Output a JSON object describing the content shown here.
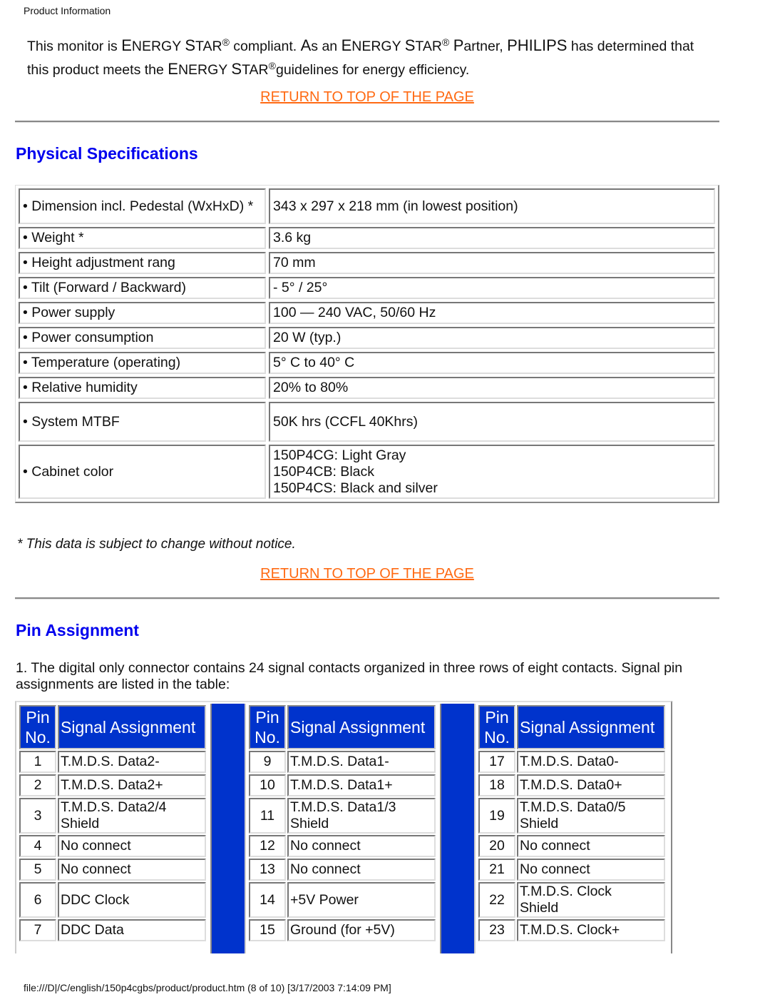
{
  "header": {
    "title": "Product Information"
  },
  "energy_star": {
    "p1": "This monitor is ",
    "es_E": "E",
    "es_NERGY": "NERGY ",
    "es_S": "S",
    "es_TAR": "TAR",
    "reg": "®",
    "p2": " compliant. ",
    "as_A": "A",
    "p3": "s an ",
    "p4": " ",
    "partner_P": "P",
    "p5": "artner, ",
    "philips": "PHILIPS",
    "p6": " has determined that this product meets the ",
    "p7": "guidelines for energy efficiency."
  },
  "links": {
    "return_top": "RETURN TO TOP OF THE PAGE"
  },
  "physical": {
    "title": "Physical Specifications",
    "rows": [
      {
        "label": "• Dimension incl. Pedestal (WxHxD) *",
        "value": "343 x 297 x 218 mm (in lowest position)"
      },
      {
        "label": "• Weight *",
        "value": "3.6 kg"
      },
      {
        "label": "• Height adjustment rang",
        "value": "70 mm"
      },
      {
        "label": "• Tilt (Forward / Backward)",
        "value": "- 5° / 25°"
      },
      {
        "label": "• Power supply",
        "value": "100 — 240 VAC, 50/60 Hz"
      },
      {
        "label": "• Power consumption",
        "value": "20 W (typ.)"
      },
      {
        "label": "• Temperature (operating)",
        "value": "5° C to 40° C"
      },
      {
        "label": "• Relative humidity",
        "value": "20% to 80%"
      },
      {
        "label": "• System MTBF",
        "value": "50K hrs (CCFL 40Khrs)"
      },
      {
        "label": "• Cabinet color",
        "value_lines": [
          "150P4CG: Light Gray",
          "150P4CB: Black",
          "150P4CS: Black and silver"
        ]
      }
    ],
    "note": "* This data is subject to change without notice."
  },
  "pin_assignment": {
    "title": "Pin Assignment",
    "intro": "1. The digital only connector contains 24 signal contacts organized in three rows of eight contacts. Signal pin assignments are listed in the table:",
    "header_pin": [
      "Pin",
      "No."
    ],
    "header_signal": "Signal Assignment",
    "tables": [
      [
        {
          "pin": "1",
          "signal": [
            "T.M.D.S. Data2-"
          ]
        },
        {
          "pin": "2",
          "signal": [
            "T.M.D.S. Data2+"
          ]
        },
        {
          "pin": "3",
          "signal": [
            "T.M.D.S. Data2/4",
            "Shield"
          ]
        },
        {
          "pin": "4",
          "signal": [
            "No connect"
          ]
        },
        {
          "pin": "5",
          "signal": [
            "No connect"
          ]
        },
        {
          "pin": "6",
          "signal": [
            "DDC Clock"
          ]
        },
        {
          "pin": "7",
          "signal": [
            "DDC Data"
          ]
        }
      ],
      [
        {
          "pin": "9",
          "signal": [
            "T.M.D.S. Data1-"
          ]
        },
        {
          "pin": "10",
          "signal": [
            "T.M.D.S. Data1+"
          ]
        },
        {
          "pin": "11",
          "signal": [
            "T.M.D.S. Data1/3",
            "Shield"
          ]
        },
        {
          "pin": "12",
          "signal": [
            "No connect"
          ]
        },
        {
          "pin": "13",
          "signal": [
            "No connect"
          ]
        },
        {
          "pin": "14",
          "signal": [
            "+5V Power"
          ]
        },
        {
          "pin": "15",
          "signal": [
            "Ground (for +5V)"
          ]
        }
      ],
      [
        {
          "pin": "17",
          "signal": [
            "T.M.D.S. Data0-"
          ]
        },
        {
          "pin": "18",
          "signal": [
            "T.M.D.S. Data0+"
          ]
        },
        {
          "pin": "19",
          "signal": [
            "T.M.D.S. Data0/5",
            "Shield"
          ]
        },
        {
          "pin": "20",
          "signal": [
            "No connect"
          ]
        },
        {
          "pin": "21",
          "signal": [
            "No connect"
          ]
        },
        {
          "pin": "22",
          "signal": [
            "T.M.D.S. Clock",
            "Shield"
          ]
        },
        {
          "pin": "23",
          "signal": [
            "T.M.D.S. Clock+"
          ]
        }
      ]
    ]
  },
  "footer": {
    "path": "file:///D|/C/english/150p4cgbs/product/product.htm (8 of 10) [3/17/2003 7:14:09 PM]"
  },
  "colors": {
    "link": "#ff6a13",
    "heading": "#0000ee",
    "table_header": "#0033cc"
  }
}
